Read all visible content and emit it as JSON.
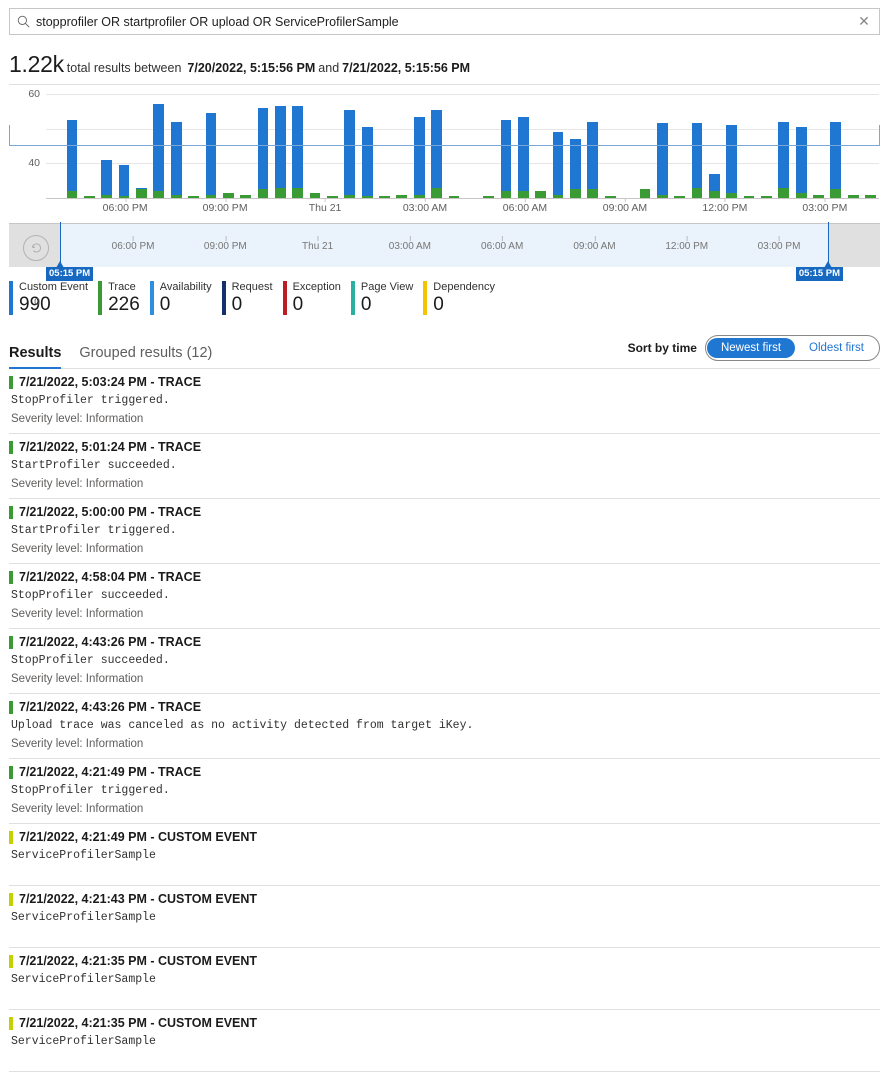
{
  "search": {
    "icon": "search-icon",
    "value": "stopprofiler OR startprofiler OR upload OR ServiceProfilerSample",
    "placeholder": "Search",
    "clear_label": "✕"
  },
  "summary": {
    "count": "1.22k",
    "text_before": "total results between",
    "start": "7/20/2022, 5:15:56 PM",
    "conjunction": "and",
    "end": "7/21/2022, 5:15:56 PM"
  },
  "chart_data": {
    "type": "bar",
    "stacked": true,
    "title": "",
    "xlabel": "",
    "ylabel": "",
    "ylim": [
      0,
      60
    ],
    "yticks": [
      0,
      20,
      40,
      60
    ],
    "grid": true,
    "legend_position": "below",
    "xtick_labels": [
      "06:00 PM",
      "09:00 PM",
      "Thu 21",
      "03:00 AM",
      "06:00 AM",
      "09:00 AM",
      "12:00 PM",
      "03:00 PM"
    ],
    "xtick_positions_pct": [
      9.5,
      21.5,
      33.5,
      45.5,
      57.5,
      69.5,
      81.5,
      93.5
    ],
    "series": [
      {
        "name": "Trace",
        "color": "#3a9b35",
        "values": [
          0,
          4,
          1,
          2,
          1,
          5,
          4,
          2,
          1,
          2,
          3,
          2,
          5,
          6,
          6,
          3,
          1,
          2,
          1,
          1,
          2,
          2,
          6,
          1,
          0,
          1,
          4,
          4,
          4,
          2,
          5,
          5,
          1,
          0,
          5,
          2,
          1,
          6,
          4,
          3,
          1,
          1,
          6,
          3,
          2,
          5,
          2,
          2
        ]
      },
      {
        "name": "Custom Event",
        "color": "#2077d2",
        "values": [
          0,
          41,
          0,
          20,
          18,
          1,
          50,
          42,
          0,
          47,
          0,
          0,
          47,
          47,
          47,
          0,
          0,
          49,
          40,
          0,
          0,
          45,
          45,
          0,
          0,
          0,
          41,
          43,
          0,
          36,
          29,
          39,
          0,
          0,
          0,
          41,
          0,
          37,
          10,
          39,
          0,
          0,
          38,
          38,
          0,
          39,
          0,
          0
        ]
      }
    ]
  },
  "slider": {
    "reset_icon": "undo-icon",
    "left_label": "05:15 PM",
    "right_label": "05:15 PM",
    "xtick_labels": [
      "06:00 PM",
      "09:00 PM",
      "Thu 21",
      "03:00 AM",
      "06:00 AM",
      "09:00 AM",
      "12:00 PM",
      "03:00 PM"
    ],
    "xtick_positions_pct": [
      9.5,
      21.5,
      33.5,
      45.5,
      57.5,
      69.5,
      81.5,
      93.5
    ]
  },
  "metrics": [
    {
      "label": "Custom Event",
      "value": "990",
      "color": "#2077d2"
    },
    {
      "label": "Trace",
      "value": "226",
      "color": "#3a9b35"
    },
    {
      "label": "Availability",
      "value": "0",
      "color": "#2d8fe0"
    },
    {
      "label": "Request",
      "value": "0",
      "color": "#16306e"
    },
    {
      "label": "Exception",
      "value": "0",
      "color": "#bc1f22"
    },
    {
      "label": "Page View",
      "value": "0",
      "color": "#2ab0a0"
    },
    {
      "label": "Dependency",
      "value": "0",
      "color": "#f5c400"
    }
  ],
  "tabs": [
    {
      "label": "Results",
      "active": true
    },
    {
      "label": "Grouped results (12)",
      "active": false
    }
  ],
  "sort": {
    "label": "Sort by time",
    "options": [
      {
        "label": "Newest first",
        "selected": true
      },
      {
        "label": "Oldest first",
        "selected": false
      }
    ]
  },
  "results": [
    {
      "title": "7/21/2022, 5:03:24 PM - TRACE",
      "accent": "#3a9b35",
      "body": "StopProfiler triggered.",
      "severity": "Severity level: Information",
      "tall": false
    },
    {
      "title": "7/21/2022, 5:01:24 PM - TRACE",
      "accent": "#3a9b35",
      "body": "StartProfiler succeeded.",
      "severity": "Severity level: Information",
      "tall": false
    },
    {
      "title": "7/21/2022, 5:00:00 PM - TRACE",
      "accent": "#3a9b35",
      "body": "StartProfiler triggered.",
      "severity": "Severity level: Information",
      "tall": false
    },
    {
      "title": "7/21/2022, 4:58:04 PM - TRACE",
      "accent": "#3a9b35",
      "body": "StopProfiler succeeded.",
      "severity": "Severity level: Information",
      "tall": false
    },
    {
      "title": "7/21/2022, 4:43:26 PM - TRACE",
      "accent": "#3a9b35",
      "body": "StopProfiler succeeded.",
      "severity": "Severity level: Information",
      "tall": false
    },
    {
      "title": "7/21/2022, 4:43:26 PM - TRACE",
      "accent": "#3a9b35",
      "body": "Upload trace was canceled as no activity detected from target iKey.",
      "severity": "Severity level: Information",
      "tall": false
    },
    {
      "title": "7/21/2022, 4:21:49 PM - TRACE",
      "accent": "#3a9b35",
      "body": "StopProfiler triggered.",
      "severity": "Severity level: Information",
      "tall": false
    },
    {
      "title": "7/21/2022, 4:21:49 PM - CUSTOM EVENT",
      "accent": "#c3d100",
      "body": "ServiceProfilerSample",
      "severity": "",
      "tall": true
    },
    {
      "title": "7/21/2022, 4:21:43 PM - CUSTOM EVENT",
      "accent": "#c3d100",
      "body": "ServiceProfilerSample",
      "severity": "",
      "tall": true
    },
    {
      "title": "7/21/2022, 4:21:35 PM - CUSTOM EVENT",
      "accent": "#c3d100",
      "body": "ServiceProfilerSample",
      "severity": "",
      "tall": true
    },
    {
      "title": "7/21/2022, 4:21:35 PM - CUSTOM EVENT",
      "accent": "#c3d100",
      "body": "ServiceProfilerSample",
      "severity": "",
      "tall": true
    }
  ]
}
